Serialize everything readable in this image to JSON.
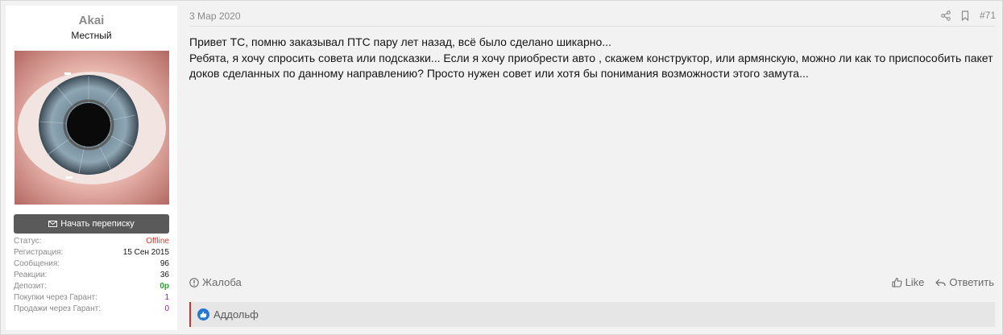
{
  "user": {
    "name": "Akai",
    "title": "Местный",
    "pm_button_label": "Начать переписку",
    "stats": [
      {
        "label": "Статус:",
        "value": "Offline",
        "kind": "offline"
      },
      {
        "label": "Регистрация:",
        "value": "15 Сен 2015",
        "kind": "normal"
      },
      {
        "label": "Сообщения:",
        "value": "96",
        "kind": "normal"
      },
      {
        "label": "Реакции:",
        "value": "36",
        "kind": "normal"
      },
      {
        "label": "Депозит:",
        "value": "0р",
        "kind": "deposit"
      },
      {
        "label": "Покупки через Гарант:",
        "value": "1",
        "kind": "purple"
      },
      {
        "label": "Продажи через Гарант:",
        "value": "0",
        "kind": "purple"
      }
    ]
  },
  "post": {
    "date": "3 Мар 2020",
    "number": "#71",
    "lines": [
      "Привет ТС, помню заказывал ПТС пару лет назад, всё было сделано шикарно...",
      "Ребята, я хочу спросить совета или подсказки... Если я хочу приобрести авто , скажем конструктор, или армянскую, можно ли как то приспособить пакет доков сделанных по данному направлению? Просто нужен совет или хотя бы понимания возможности этого замута..."
    ]
  },
  "footer": {
    "report_label": "Жалоба",
    "like_label": "Like",
    "reply_label": "Ответить"
  },
  "reactions": {
    "users": "Аддольф"
  },
  "colors": {
    "status_offline": "#e0362b",
    "deposit": "#2a9d2a",
    "guarantor": "#9b1e9b",
    "like_badge": "#2577d3",
    "reaction_border": "#c0392b"
  }
}
